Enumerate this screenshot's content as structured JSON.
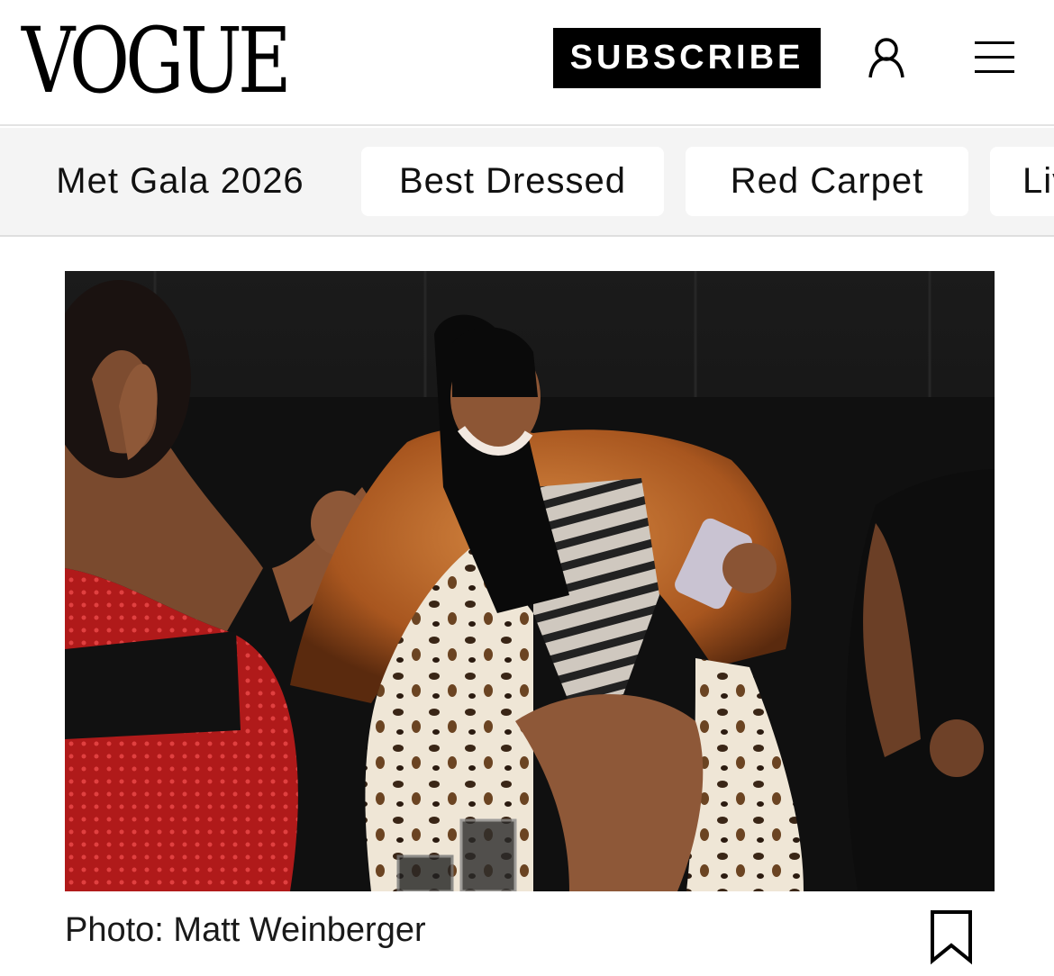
{
  "header": {
    "logo": "VOGUE",
    "subscribe_label": "SUBSCRIBE",
    "account_icon": "account-icon",
    "menu_icon": "hamburger-menu-icon"
  },
  "nav": {
    "chips": [
      {
        "label": "Met Gala 2026",
        "active": true
      },
      {
        "label": "Best Dressed",
        "active": false
      },
      {
        "label": "Red Carpet",
        "active": false
      },
      {
        "label": "Liv",
        "active": false
      }
    ]
  },
  "article": {
    "photo_caption": "Photo: Matt Weinberger",
    "bookmark_icon": "bookmark-icon"
  },
  "colors": {
    "brand": "#000000",
    "nav_bg": "#f4f4f4",
    "chip_bg": "#ffffff"
  }
}
